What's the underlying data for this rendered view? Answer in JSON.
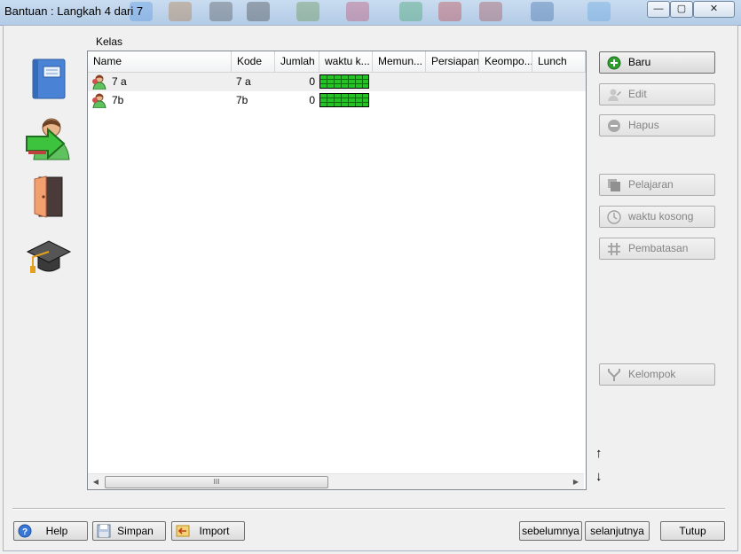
{
  "window": {
    "title": "Bantuan : Langkah 4 dari 7",
    "min_glyph": "—",
    "max_glyph": "▢",
    "close_glyph": "✕"
  },
  "sidebar": {
    "icons": [
      "book-icon",
      "teacher-arrow-icon",
      "door-icon",
      "graduation-cap-icon"
    ]
  },
  "grid": {
    "caption": "Kelas",
    "columns": [
      "Name",
      "Kode",
      "Jumlah",
      "waktu k...",
      "Memun...",
      "Persiapan",
      "Keompo...",
      "Lunch"
    ],
    "rows": [
      {
        "name": "7 a",
        "kode": "7 a",
        "jumlah": "0"
      },
      {
        "name": "7b",
        "kode": "7b",
        "jumlah": "0"
      }
    ],
    "scroll_thumb_glyph": "III",
    "scroll_left_glyph": "◀",
    "scroll_right_glyph": "▶"
  },
  "actions": {
    "baru": "Baru",
    "edit": "Edit",
    "hapus": "Hapus",
    "pelajaran": "Pelajaran",
    "waktu_kosong": "waktu kosong",
    "pembatasan": "Pembatasan",
    "kelompok": "Kelompok",
    "up_glyph": "↑",
    "down_glyph": "↓"
  },
  "footer": {
    "help": "Help",
    "simpan": "Simpan",
    "import": "Import",
    "sebelumnya": "sebelumnya",
    "selanjutnya": "selanjutnya",
    "tutup": "Tutup"
  },
  "colors": {
    "grid_fill": "#22c322",
    "selected_row": "#efefef",
    "add_green": "#2e9e2e"
  }
}
